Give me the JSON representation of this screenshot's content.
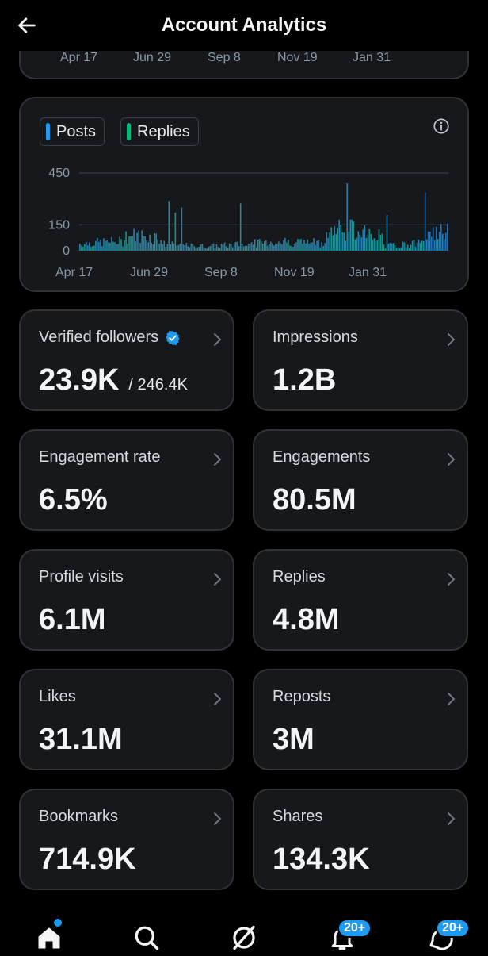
{
  "header": {
    "title": "Account Analytics",
    "back_icon": "arrow-left-icon"
  },
  "top_axis": {
    "labels": [
      "Apr 17",
      "Jun 29",
      "Sep 8",
      "Nov 19",
      "Jan 31"
    ]
  },
  "chart_data": {
    "type": "bar",
    "legend": [
      {
        "name": "Posts",
        "color": "#1d9bf0"
      },
      {
        "name": "Replies",
        "color": "#00ba7c"
      }
    ],
    "y_ticks": [
      450,
      150,
      0
    ],
    "ylim": [
      0,
      450
    ],
    "x_tick_labels": [
      "Apr 17",
      "Jun 29",
      "Sep 8",
      "Nov 19",
      "Jan 31"
    ],
    "grid": true,
    "info_icon": "info-circle-icon"
  },
  "stats": [
    {
      "label": "Verified followers",
      "value": "23.9K",
      "sub": "/ 246.4K",
      "verified": true
    },
    {
      "label": "Impressions",
      "value": "1.2B"
    },
    {
      "label": "Engagement rate",
      "value": "6.5%"
    },
    {
      "label": "Engagements",
      "value": "80.5M"
    },
    {
      "label": "Profile visits",
      "value": "6.1M"
    },
    {
      "label": "Replies",
      "value": "4.8M"
    },
    {
      "label": "Likes",
      "value": "31.1M"
    },
    {
      "label": "Reposts",
      "value": "3M"
    },
    {
      "label": "Bookmarks",
      "value": "714.9K"
    },
    {
      "label": "Shares",
      "value": "134.3K"
    }
  ],
  "nav": {
    "items": [
      "home-icon",
      "search-icon",
      "grok-icon",
      "bell-icon",
      "messages-icon"
    ],
    "notifications_badge": "20+",
    "messages_badge": "20+",
    "accent": "#1d9bf0"
  }
}
